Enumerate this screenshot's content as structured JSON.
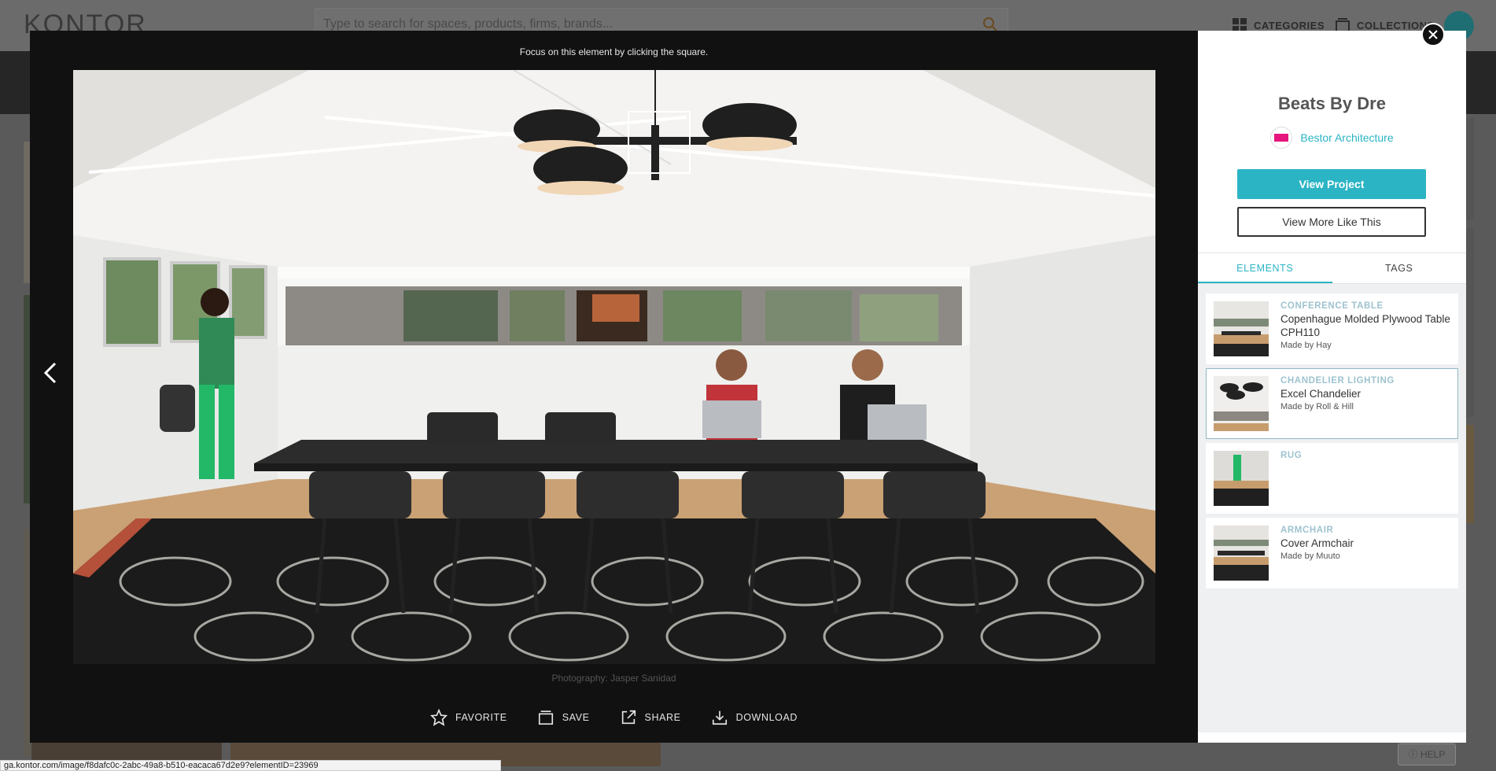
{
  "site": {
    "logo": "KONTOR",
    "search_placeholder": "Type to search for spaces, products, firms, brands...",
    "nav_categories": "CATEGORIES",
    "nav_collections": "COLLECTIONS",
    "help": "HELP",
    "status_url": "ga.kontor.com/image/f8dafc0c-2abc-49a8-b510-eacaca67d2e9?elementID=23969"
  },
  "viewer": {
    "hint": "Focus on this element by clicking the square.",
    "credit": "Photography: Jasper Sanidad",
    "actions": {
      "favorite": "FAVORITE",
      "save": "SAVE",
      "share": "SHARE",
      "download": "DOWNLOAD"
    }
  },
  "panel": {
    "title": "Beats By Dre",
    "firm": "Bestor Architecture",
    "view_project": "View Project",
    "view_more": "View More Like This",
    "tabs": [
      "ELEMENTS",
      "TAGS"
    ],
    "active_tab": "ELEMENTS",
    "elements": [
      {
        "category": "CONFERENCE TABLE",
        "name": "Copenhague Molded Plywood Table CPH110",
        "maker": "Made by Hay",
        "selected": false
      },
      {
        "category": "CHANDELIER LIGHTING",
        "name": "Excel Chandelier",
        "maker": "Made by Roll & Hill",
        "selected": true
      },
      {
        "category": "RUG",
        "name": "",
        "maker": "",
        "selected": false
      },
      {
        "category": "ARMCHAIR",
        "name": "Cover Armchair",
        "maker": "Made by Muuto",
        "selected": false
      }
    ]
  },
  "colors": {
    "accent": "#2bb4c4",
    "modal_bg": "#111111",
    "firm_logo": "#e6167d"
  }
}
